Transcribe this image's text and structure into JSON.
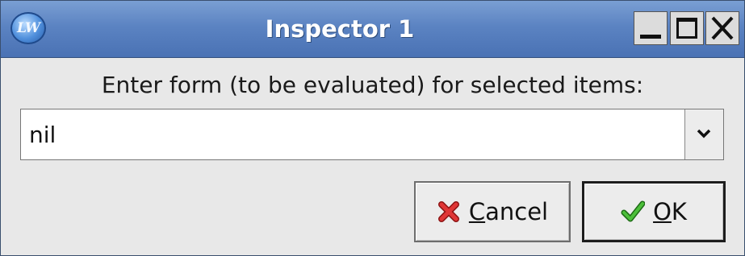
{
  "window": {
    "title": "Inspector 1",
    "app_icon_text": "LW"
  },
  "prompt": {
    "text": "Enter form (to be evaluated) for selected items:"
  },
  "combo": {
    "value": "nil"
  },
  "buttons": {
    "cancel": {
      "mnemonic": "C",
      "rest": "ancel"
    },
    "ok": {
      "mnemonic": "O",
      "rest": "K"
    }
  },
  "icons": {
    "app": "lispworks-icon",
    "minimize": "minimize-icon",
    "maximize": "maximize-icon",
    "close": "close-icon",
    "dropdown": "chevron-down-icon",
    "cancel": "red-x-icon",
    "ok": "green-check-icon"
  },
  "colors": {
    "titlebar": "#5b83c2",
    "cancel_icon": "#d42a2a",
    "ok_icon": "#3aa52c"
  }
}
